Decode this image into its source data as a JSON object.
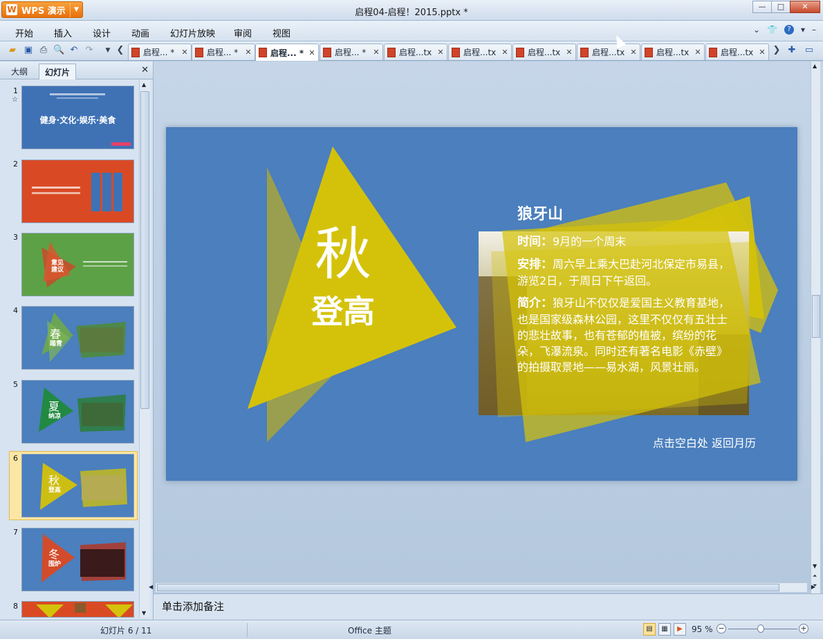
{
  "app": {
    "name": "WPS 演示",
    "window_title": "启程04-启程！2015.pptx *"
  },
  "menu": [
    "开始",
    "插入",
    "设计",
    "动画",
    "幻灯片放映",
    "审阅",
    "视图"
  ],
  "tabs": [
    {
      "label": "启程... *"
    },
    {
      "label": "启程... *"
    },
    {
      "label": "启程... *",
      "active": true
    },
    {
      "label": "启程... *"
    },
    {
      "label": "启程...tx"
    },
    {
      "label": "启程...tx"
    },
    {
      "label": "启程...tx"
    },
    {
      "label": "启程...tx"
    },
    {
      "label": "启程...tx"
    },
    {
      "label": "启程...tx"
    }
  ],
  "left_panel": {
    "tabs": [
      "大纲",
      "幻灯片"
    ],
    "slide_numbers": [
      "1",
      "2",
      "3",
      "4",
      "5",
      "6",
      "7",
      "8"
    ],
    "thumbs": {
      "t1_title": "健身·文化·娱乐·美食",
      "t3_label": "意见\n建议",
      "t4_big": "春",
      "t4_small": "踏青",
      "t5_big": "夏",
      "t5_small": "纳凉",
      "t6_big": "秋",
      "t6_small": "登高",
      "t7_big": "冬",
      "t7_small": "围炉"
    }
  },
  "slide": {
    "season_char": "秋",
    "season_sub": "登高",
    "place": "狼牙山",
    "time_label": "时间：",
    "time_value": "9月的一个周末",
    "plan_label": "安排：",
    "plan_value": "周六早上乘大巴赴河北保定市易县，游览2日，于周日下午返回。",
    "intro_label": "简介：",
    "intro_value": "狼牙山不仅仅是爱国主义教育基地，也是国家级森林公园，这里不仅仅有五壮士的悲壮故事，也有苍郁的植被，缤纷的花朵，飞瀑流泉。同时还有著名电影《赤壁》的拍摄取景地——易水湖，风景壮丽。",
    "back_link": "点击空白处 返回月历",
    "colors": {
      "background": "#4b7fbd",
      "yellow": "#d4c20a",
      "text": "#ffffff"
    }
  },
  "notes_placeholder": "单击添加备注",
  "status": {
    "slide_counter": "幻灯片 6 / 11",
    "theme": "Office 主题",
    "zoom": "95 %"
  }
}
